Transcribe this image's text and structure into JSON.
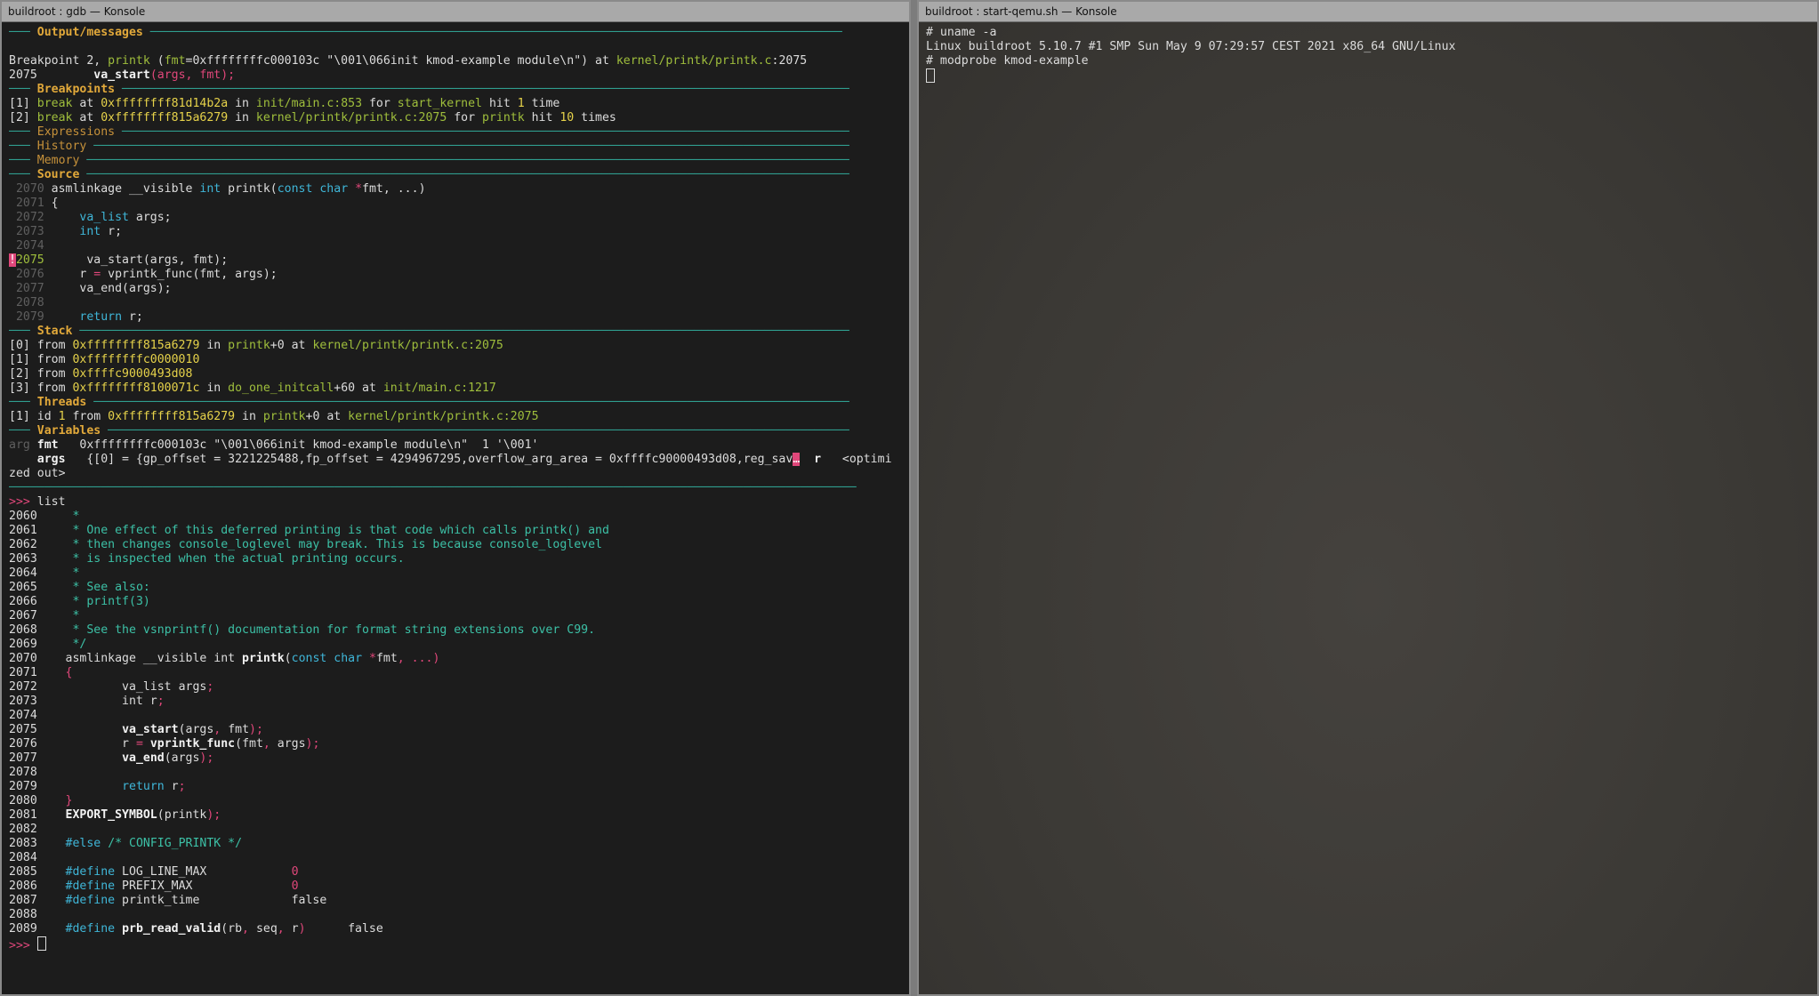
{
  "left_window": {
    "title": "buildroot : gdb — Konsole",
    "lines": [
      [
        {
          "t": "─── ",
          "c": "sep"
        },
        {
          "t": "Output/messages",
          "c": "hdr"
        },
        {
          "t": " ──────────────────────────────────────────────────────────────────────────────────────────────────",
          "c": "sep"
        }
      ],
      [
        {
          "t": ""
        }
      ],
      [
        {
          "t": "Breakpoint 2, "
        },
        {
          "t": "printk",
          "c": "g"
        },
        {
          "t": " ("
        },
        {
          "t": "fmt",
          "c": "g"
        },
        {
          "t": "=0xffffffffc000103c \"\\001\\066init kmod-example module\\n\") at "
        },
        {
          "t": "kernel/printk/printk.c",
          "c": "g"
        },
        {
          "t": ":2075"
        }
      ],
      [
        {
          "t": "2075\t    "
        },
        {
          "t": "va_start",
          "c": "b"
        },
        {
          "t": "(args, fmt);",
          "c": "rd"
        }
      ],
      [
        {
          "t": "─── ",
          "c": "sep"
        },
        {
          "t": "Breakpoints",
          "c": "hdr"
        },
        {
          "t": " ───────────────────────────────────────────────────────────────────────────────────────────────────────",
          "c": "sep"
        }
      ],
      [
        {
          "t": "[1] "
        },
        {
          "t": "break",
          "c": "g"
        },
        {
          "t": " at "
        },
        {
          "t": "0xffffffff81d14b2a",
          "c": "y"
        },
        {
          "t": " in "
        },
        {
          "t": "init/main.c:853",
          "c": "g"
        },
        {
          "t": " for "
        },
        {
          "t": "start_kernel",
          "c": "g"
        },
        {
          "t": " hit "
        },
        {
          "t": "1",
          "c": "y"
        },
        {
          "t": " time"
        }
      ],
      [
        {
          "t": "[2] "
        },
        {
          "t": "break",
          "c": "g"
        },
        {
          "t": " at "
        },
        {
          "t": "0xffffffff815a6279",
          "c": "y"
        },
        {
          "t": " in "
        },
        {
          "t": "kernel/printk/printk.c:2075",
          "c": "g"
        },
        {
          "t": " for "
        },
        {
          "t": "printk",
          "c": "g"
        },
        {
          "t": " hit "
        },
        {
          "t": "10",
          "c": "y"
        },
        {
          "t": " times"
        }
      ],
      [
        {
          "t": "─── ",
          "c": "sep"
        },
        {
          "t": "Expressions",
          "c": "hdrdim"
        },
        {
          "t": " ───────────────────────────────────────────────────────────────────────────────────────────────────────",
          "c": "sep"
        }
      ],
      [
        {
          "t": "─── ",
          "c": "sep"
        },
        {
          "t": "History",
          "c": "hdrdim"
        },
        {
          "t": " ───────────────────────────────────────────────────────────────────────────────────────────────────────────",
          "c": "sep"
        }
      ],
      [
        {
          "t": "─── ",
          "c": "sep"
        },
        {
          "t": "Memory",
          "c": "hdrdim"
        },
        {
          "t": " ────────────────────────────────────────────────────────────────────────────────────────────────────────────",
          "c": "sep"
        }
      ],
      [
        {
          "t": "─── ",
          "c": "sep"
        },
        {
          "t": "Source",
          "c": "hdr"
        },
        {
          "t": " ────────────────────────────────────────────────────────────────────────────────────────────────────────────",
          "c": "sep"
        }
      ],
      [
        {
          "t": " 2070 ",
          "c": "dim"
        },
        {
          "t": "asmlinkage __visible "
        },
        {
          "t": "int",
          "c": "cy"
        },
        {
          "t": " printk("
        },
        {
          "t": "const char",
          "c": "cy"
        },
        {
          "t": " "
        },
        {
          "t": "*",
          "c": "rd"
        },
        {
          "t": "fmt, ...)"
        }
      ],
      [
        {
          "t": " 2071 ",
          "c": "dim"
        },
        {
          "t": "{"
        }
      ],
      [
        {
          "t": " 2072 ",
          "c": "dim"
        },
        {
          "t": "    "
        },
        {
          "t": "va_list",
          "c": "cy"
        },
        {
          "t": " args;"
        }
      ],
      [
        {
          "t": " 2073 ",
          "c": "dim"
        },
        {
          "t": "    "
        },
        {
          "t": "int",
          "c": "cy"
        },
        {
          "t": " r;"
        }
      ],
      [
        {
          "t": " 2074 ",
          "c": "dim"
        }
      ],
      [
        {
          "t": "!",
          "c": "marker"
        },
        {
          "t": "2075",
          "c": "g"
        },
        {
          "t": "      va_start(args, fmt);"
        }
      ],
      [
        {
          "t": " 2076 ",
          "c": "dim"
        },
        {
          "t": "    r "
        },
        {
          "t": "=",
          "c": "rd"
        },
        {
          "t": " vprintk_func(fmt, args);"
        }
      ],
      [
        {
          "t": " 2077 ",
          "c": "dim"
        },
        {
          "t": "    va_end(args);"
        }
      ],
      [
        {
          "t": " 2078 ",
          "c": "dim"
        }
      ],
      [
        {
          "t": " 2079 ",
          "c": "dim"
        },
        {
          "t": "    "
        },
        {
          "t": "return",
          "c": "cy"
        },
        {
          "t": " r;"
        }
      ],
      [
        {
          "t": "─── ",
          "c": "sep"
        },
        {
          "t": "Stack",
          "c": "hdr"
        },
        {
          "t": " ─────────────────────────────────────────────────────────────────────────────────────────────────────────────",
          "c": "sep"
        }
      ],
      [
        {
          "t": "[0] from "
        },
        {
          "t": "0xffffffff815a6279",
          "c": "y"
        },
        {
          "t": " in "
        },
        {
          "t": "printk",
          "c": "g"
        },
        {
          "t": "+0 at "
        },
        {
          "t": "kernel/printk/printk.c:2075",
          "c": "g"
        }
      ],
      [
        {
          "t": "[1] from "
        },
        {
          "t": "0xffffffffc0000010",
          "c": "y"
        }
      ],
      [
        {
          "t": "[2] from "
        },
        {
          "t": "0xffffc9000493d08",
          "c": "y"
        }
      ],
      [
        {
          "t": "[3] from "
        },
        {
          "t": "0xffffffff8100071c",
          "c": "y"
        },
        {
          "t": " in "
        },
        {
          "t": "do_one_initcall",
          "c": "g"
        },
        {
          "t": "+60 at "
        },
        {
          "t": "init/main.c:1217",
          "c": "g"
        }
      ],
      [
        {
          "t": "─── ",
          "c": "sep"
        },
        {
          "t": "Threads",
          "c": "hdr"
        },
        {
          "t": " ───────────────────────────────────────────────────────────────────────────────────────────────────────────",
          "c": "sep"
        }
      ],
      [
        {
          "t": "[1] id "
        },
        {
          "t": "1",
          "c": "y"
        },
        {
          "t": " from "
        },
        {
          "t": "0xffffffff815a6279",
          "c": "y"
        },
        {
          "t": " in "
        },
        {
          "t": "printk",
          "c": "g"
        },
        {
          "t": "+0 at "
        },
        {
          "t": "kernel/printk/printk.c:2075",
          "c": "g"
        }
      ],
      [
        {
          "t": "─── ",
          "c": "sep"
        },
        {
          "t": "Variables",
          "c": "hdr"
        },
        {
          "t": " ─────────────────────────────────────────────────────────────────────────────────────────────────────────",
          "c": "sep"
        }
      ],
      [
        {
          "t": "arg ",
          "c": "dim"
        },
        {
          "t": "fmt",
          "c": "b"
        },
        {
          "t": "   0xffffffffc000103c \"\\001\\066init kmod-example module\\n\"  1 '\\001'"
        }
      ],
      [
        {
          "t": "    "
        },
        {
          "t": "args",
          "c": "b"
        },
        {
          "t": "   {[0] = {gp_offset = 3221225488,fp_offset = 4294967295,overflow_arg_area = 0xffffc90000493d08,reg_sav"
        },
        {
          "t": "…",
          "c": "marker"
        },
        {
          "t": "  "
        },
        {
          "t": "r",
          "c": "b"
        },
        {
          "t": "   <optimi"
        }
      ],
      [
        {
          "t": "zed out>"
        }
      ],
      [
        {
          "t": "────────────────────────────────────────────────────────────────────────────────────────────────────────────────────────",
          "c": "sep"
        }
      ],
      [
        {
          "t": ">>> ",
          "c": "prompt"
        },
        {
          "t": "list"
        }
      ],
      [
        {
          "t": "2060\t "
        },
        {
          "t": "*",
          "c": "tq"
        }
      ],
      [
        {
          "t": "2061\t "
        },
        {
          "t": "* One effect of this deferred printing is that code which calls printk() and",
          "c": "tq"
        }
      ],
      [
        {
          "t": "2062\t "
        },
        {
          "t": "* then changes console_loglevel may break. This is because console_loglevel",
          "c": "tq"
        }
      ],
      [
        {
          "t": "2063\t "
        },
        {
          "t": "* is inspected when the actual printing occurs.",
          "c": "tq"
        }
      ],
      [
        {
          "t": "2064\t "
        },
        {
          "t": "*",
          "c": "tq"
        }
      ],
      [
        {
          "t": "2065\t "
        },
        {
          "t": "* See also:",
          "c": "tq"
        }
      ],
      [
        {
          "t": "2066\t "
        },
        {
          "t": "* printf(3)",
          "c": "tq"
        }
      ],
      [
        {
          "t": "2067\t "
        },
        {
          "t": "*",
          "c": "tq"
        }
      ],
      [
        {
          "t": "2068\t "
        },
        {
          "t": "* See the vsnprintf() documentation for format string extensions over C99.",
          "c": "tq"
        }
      ],
      [
        {
          "t": "2069\t "
        },
        {
          "t": "*/",
          "c": "tq"
        }
      ],
      [
        {
          "t": "2070\tasmlinkage __visible int "
        },
        {
          "t": "printk",
          "c": "b"
        },
        {
          "t": "("
        },
        {
          "t": "const char",
          "c": "cy"
        },
        {
          "t": " "
        },
        {
          "t": "*",
          "c": "rd"
        },
        {
          "t": "fmt"
        },
        {
          "t": ", ...)",
          "c": "rd"
        }
      ],
      [
        {
          "t": "2071\t"
        },
        {
          "t": "{",
          "c": "rd"
        }
      ],
      [
        {
          "t": "2072\t        va_list args"
        },
        {
          "t": ";",
          "c": "rd"
        }
      ],
      [
        {
          "t": "2073\t        int r"
        },
        {
          "t": ";",
          "c": "rd"
        }
      ],
      [
        {
          "t": "2074"
        }
      ],
      [
        {
          "t": "2075\t        "
        },
        {
          "t": "va_start",
          "c": "b"
        },
        {
          "t": "(args"
        },
        {
          "t": ", ",
          "c": "rd"
        },
        {
          "t": "fmt"
        },
        {
          "t": ");",
          "c": "rd"
        }
      ],
      [
        {
          "t": "2076\t        r "
        },
        {
          "t": "=",
          "c": "rd"
        },
        {
          "t": " "
        },
        {
          "t": "vprintk_func",
          "c": "b"
        },
        {
          "t": "(fmt"
        },
        {
          "t": ", ",
          "c": "rd"
        },
        {
          "t": "args"
        },
        {
          "t": ");",
          "c": "rd"
        }
      ],
      [
        {
          "t": "2077\t        "
        },
        {
          "t": "va_end",
          "c": "b"
        },
        {
          "t": "(args"
        },
        {
          "t": ");",
          "c": "rd"
        }
      ],
      [
        {
          "t": "2078"
        }
      ],
      [
        {
          "t": "2079\t        "
        },
        {
          "t": "return",
          "c": "cy"
        },
        {
          "t": " r"
        },
        {
          "t": ";",
          "c": "rd"
        }
      ],
      [
        {
          "t": "2080\t"
        },
        {
          "t": "}",
          "c": "rd"
        }
      ],
      [
        {
          "t": "2081\t"
        },
        {
          "t": "EXPORT_SYMBOL",
          "c": "b"
        },
        {
          "t": "(printk"
        },
        {
          "t": ");",
          "c": "rd"
        }
      ],
      [
        {
          "t": "2082"
        }
      ],
      [
        {
          "t": "2083\t"
        },
        {
          "t": "#else",
          "c": "cy"
        },
        {
          "t": " "
        },
        {
          "t": "/* CONFIG_PRINTK */",
          "c": "tq"
        }
      ],
      [
        {
          "t": "2084"
        }
      ],
      [
        {
          "t": "2085\t"
        },
        {
          "t": "#define",
          "c": "cy"
        },
        {
          "t": " LOG_LINE_MAX\t\t"
        },
        {
          "t": "0",
          "c": "rd"
        }
      ],
      [
        {
          "t": "2086\t"
        },
        {
          "t": "#define",
          "c": "cy"
        },
        {
          "t": " PREFIX_MAX\t\t"
        },
        {
          "t": "0",
          "c": "rd"
        }
      ],
      [
        {
          "t": "2087\t"
        },
        {
          "t": "#define",
          "c": "cy"
        },
        {
          "t": " printk_time\t\tfalse"
        }
      ],
      [
        {
          "t": "2088"
        }
      ],
      [
        {
          "t": "2089\t"
        },
        {
          "t": "#define",
          "c": "cy"
        },
        {
          "t": " "
        },
        {
          "t": "prb_read_valid",
          "c": "b"
        },
        {
          "t": "(rb"
        },
        {
          "t": ", ",
          "c": "rd"
        },
        {
          "t": "seq"
        },
        {
          "t": ", ",
          "c": "rd"
        },
        {
          "t": "r"
        },
        {
          "t": ")",
          "c": "rd"
        },
        {
          "t": "\tfalse"
        }
      ]
    ],
    "prompt": ">>> "
  },
  "right_window": {
    "title": "buildroot : start-qemu.sh — Konsole",
    "lines": [
      "# uname -a",
      "Linux buildroot 5.10.7 #1 SMP Sun May 9 07:29:57 CEST 2021 x86_64 GNU/Linux",
      "# modprobe kmod-example"
    ]
  },
  "colors": {
    "separator": "#2f9e8f",
    "header": "#e2a93a",
    "green": "#9fbe3c",
    "yellow": "#e6d24a",
    "cyan": "#3fb6d8",
    "comment": "#3cc0a6",
    "red": "#e0477a"
  },
  "icons": [
    "cursor-block",
    "kitten-wallpaper"
  ]
}
